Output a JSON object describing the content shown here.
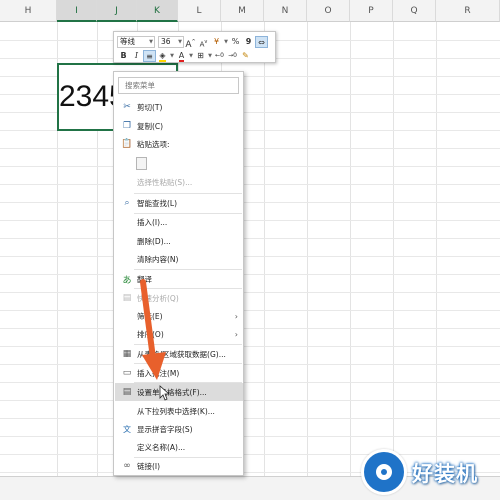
{
  "sheet": {
    "columns": [
      "H",
      "I",
      "J",
      "K",
      "L",
      "M",
      "N",
      "O",
      "P",
      "Q",
      "R"
    ],
    "cell_value": "2345"
  },
  "toolbar": {
    "font_name": "等线",
    "font_size": "36",
    "grow_font_label": "A",
    "shrink_font_label": "A",
    "currency_label": "¥",
    "percent_label": "%",
    "comma_label": "9",
    "bold_label": "B",
    "italic_label": "I",
    "merge_label": "⇔"
  },
  "menu": {
    "search_placeholder": "搜索菜单",
    "items": [
      {
        "label": "剪切(T)",
        "icon": "scissors-icon"
      },
      {
        "label": "复制(C)",
        "icon": "copy-icon"
      },
      {
        "label": "粘贴选项:",
        "icon": "clipboard-icon"
      },
      {
        "label": "选择性粘贴(S)...",
        "icon": ""
      },
      {
        "label": "智能查找(L)",
        "icon": "search-icon"
      },
      {
        "label": "插入(I)...",
        "icon": ""
      },
      {
        "label": "删除(D)...",
        "icon": ""
      },
      {
        "label": "清除内容(N)",
        "icon": ""
      },
      {
        "label": "翻译",
        "icon": "translate-icon"
      },
      {
        "label": "快速分析(Q)",
        "icon": "quick-analysis-icon"
      },
      {
        "label": "筛选(E)",
        "icon": ""
      },
      {
        "label": "排序(O)",
        "icon": ""
      },
      {
        "label": "从表格/区域获取数据(G)...",
        "icon": "table-icon"
      },
      {
        "label": "插入批注(M)",
        "icon": "comment-icon"
      },
      {
        "label": "设置单元格格式(F)...",
        "icon": "format-cells-icon"
      },
      {
        "label": "从下拉列表中选择(K)...",
        "icon": ""
      },
      {
        "label": "显示拼音字段(S)",
        "icon": "phonetic-icon"
      },
      {
        "label": "定义名称(A)...",
        "icon": ""
      },
      {
        "label": "链接(I)",
        "icon": "link-icon"
      }
    ]
  },
  "watermark": {
    "text": "好装机"
  },
  "colors": {
    "accent_green": "#217346",
    "arrow_orange": "#e8602c",
    "logo_blue": "#1f73c8"
  }
}
